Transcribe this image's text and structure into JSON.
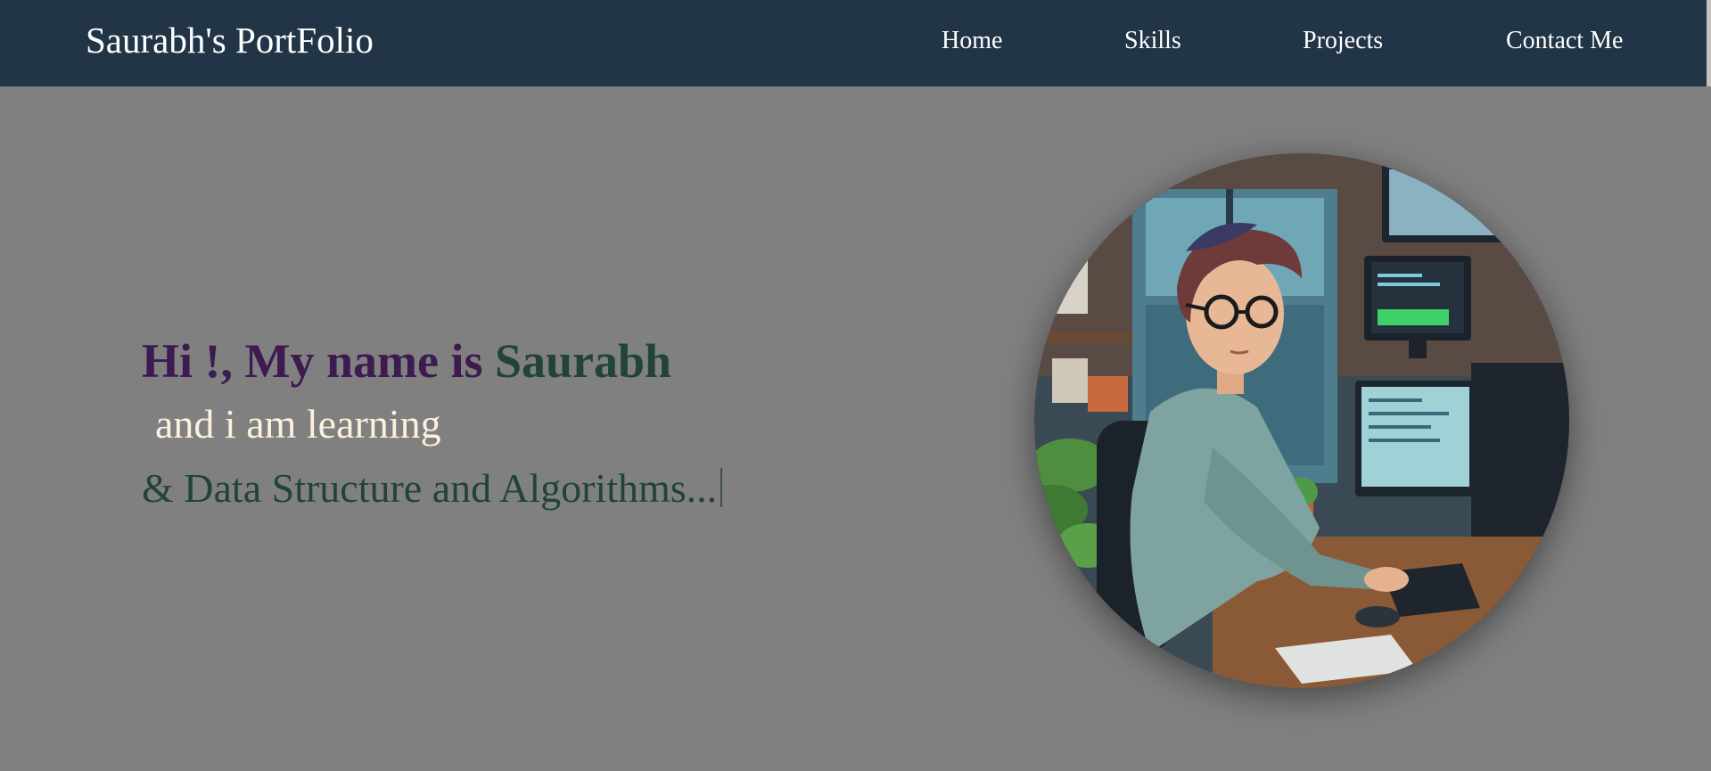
{
  "navbar": {
    "brand": "Saurabh's PortFolio",
    "links": [
      {
        "label": "Home"
      },
      {
        "label": "Skills"
      },
      {
        "label": "Projects"
      },
      {
        "label": "Contact Me"
      }
    ]
  },
  "hero": {
    "greeting_prefix": "Hi !, My name is ",
    "greeting_name": "Saurabh",
    "learning_line": "and i am learning",
    "typing_text": "& Data Structure and Algorithms..."
  },
  "colors": {
    "navbar_bg": "#213547",
    "page_bg": "#808080",
    "greeting": "#3d1a4f",
    "name": "#22433a",
    "learning": "#fdf0dc",
    "typing": "#22433a"
  },
  "avatar": {
    "icon": "developer-avatar-illustration"
  }
}
